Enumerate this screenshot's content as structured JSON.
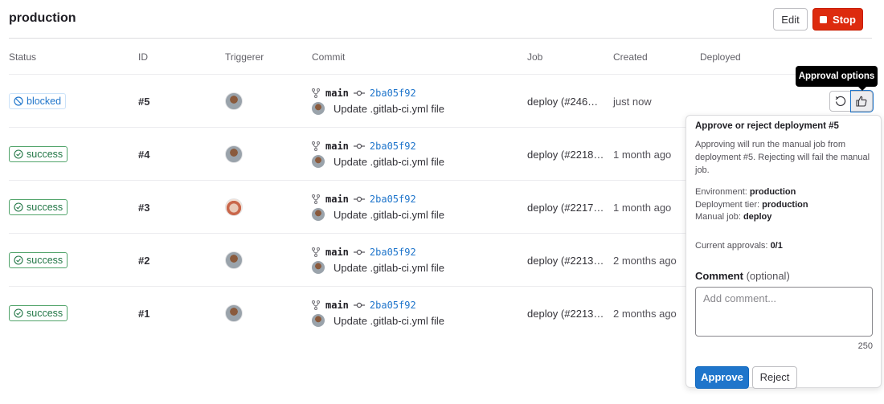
{
  "header": {
    "title": "production",
    "edit_label": "Edit",
    "stop_label": "Stop"
  },
  "table": {
    "columns": [
      "Status",
      "ID",
      "Triggerer",
      "Commit",
      "Job",
      "Created",
      "Deployed"
    ],
    "rows": [
      {
        "status": "blocked",
        "id": "#5",
        "branch": "main",
        "sha": "2ba05f92",
        "commit_title": "Update .gitlab-ci.yml file",
        "job": "deploy (#246…",
        "created": "just now",
        "deployed": ""
      },
      {
        "status": "success",
        "id": "#4",
        "branch": "main",
        "sha": "2ba05f92",
        "commit_title": "Update .gitlab-ci.yml file",
        "job": "deploy (#2218…",
        "created": "1 month ago",
        "deployed": ""
      },
      {
        "status": "success",
        "id": "#3",
        "branch": "main",
        "sha": "2ba05f92",
        "commit_title": "Update .gitlab-ci.yml file",
        "job": "deploy (#2217…",
        "created": "1 month ago",
        "deployed": ""
      },
      {
        "status": "success",
        "id": "#2",
        "branch": "main",
        "sha": "2ba05f92",
        "commit_title": "Update .gitlab-ci.yml file",
        "job": "deploy (#2213…",
        "created": "2 months ago",
        "deployed": ""
      },
      {
        "status": "success",
        "id": "#1",
        "branch": "main",
        "sha": "2ba05f92",
        "commit_title": "Update .gitlab-ci.yml file",
        "job": "deploy (#2213…",
        "created": "2 months ago",
        "deployed": ""
      }
    ]
  },
  "tooltip": "Approval options",
  "popover": {
    "title": "Approve or reject deployment #5",
    "description": "Approving will run the manual job from deployment #5. Rejecting will fail the manual job.",
    "environment_label": "Environment:",
    "environment": "production",
    "tier_label": "Deployment tier:",
    "tier": "production",
    "job_label": "Manual job:",
    "job": "deploy",
    "approvals_label": "Current approvals:",
    "approvals": "0/1",
    "comment_label": "Comment",
    "comment_optional": "(optional)",
    "comment_placeholder": "Add comment...",
    "comment_value": "",
    "char_counter": "250",
    "approve_label": "Approve",
    "reject_label": "Reject"
  },
  "colors": {
    "stop": "#dd2b0e",
    "approve": "#1f75cb",
    "blocked": "#1f75cb",
    "success": "#217645",
    "link": "#1f75cb"
  }
}
